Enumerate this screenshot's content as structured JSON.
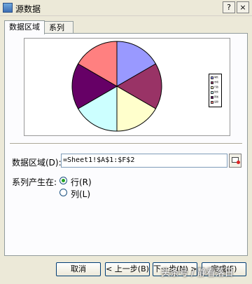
{
  "window": {
    "title": "源数据",
    "help_label": "?",
    "close_label": "×"
  },
  "tabs": [
    {
      "label": "数据区域",
      "active": true
    },
    {
      "label": "系列",
      "active": false
    }
  ],
  "chart_data": {
    "type": "pie",
    "values": [
      1,
      1,
      1,
      1,
      1,
      1
    ],
    "colors": [
      "#9999ff",
      "#993366",
      "#ffffcc",
      "#ccffff",
      "#660066",
      "#ff8080"
    ],
    "legend_position": "right"
  },
  "legend": [
    {
      "label": "销售",
      "color": "#9999ff"
    },
    {
      "label": "市场",
      "color": "#993366"
    },
    {
      "label": "行政",
      "color": "#ffffcc"
    },
    {
      "label": "财务",
      "color": "#ccffff"
    },
    {
      "label": "研发",
      "color": "#660066"
    },
    {
      "label": "后勤",
      "color": "#ff8080"
    }
  ],
  "form": {
    "range_label": "数据区域(D):",
    "range_value": "=Sheet1!$A$1:$F$2",
    "series_in_label": "系列产生在:",
    "options": [
      {
        "label": "行(R)",
        "checked": true
      },
      {
        "label": "列(L)",
        "checked": false
      }
    ]
  },
  "buttons": {
    "cancel": "取消",
    "back": "< 上一步(B)",
    "next": "下一步(N) >",
    "finish": "完成(F)"
  },
  "watermark": "头条号 / 静看落日"
}
